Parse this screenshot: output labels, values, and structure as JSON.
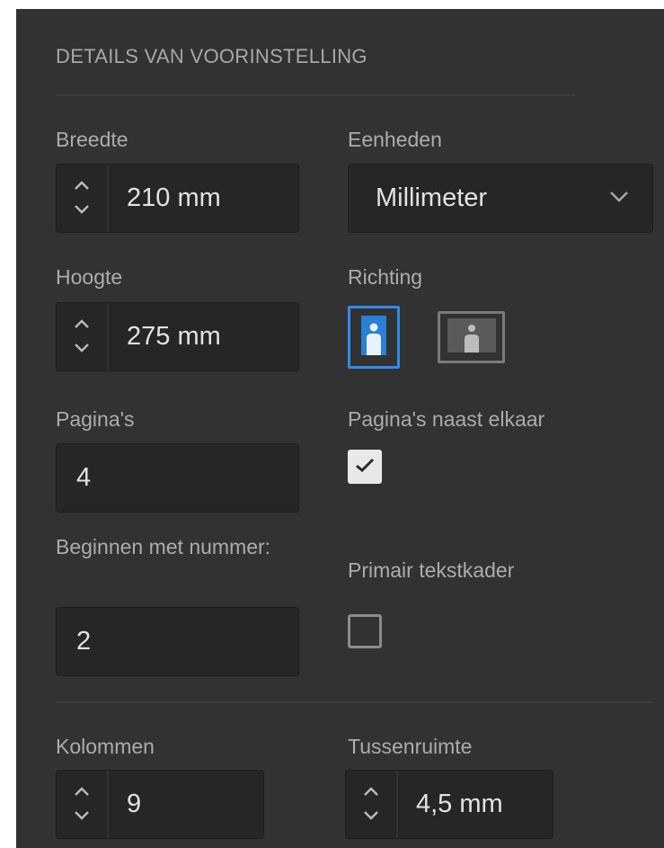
{
  "section_title": "DETAILS VAN VOORINSTELLING",
  "width": {
    "label": "Breedte",
    "value": "210 mm"
  },
  "units": {
    "label": "Eenheden",
    "value": "Millimeter"
  },
  "height": {
    "label": "Hoogte",
    "value": "275 mm"
  },
  "orientation": {
    "label": "Richting",
    "selected": "portrait",
    "accent_color": "#2d8ceb"
  },
  "pages": {
    "label": "Pagina's",
    "value": "4"
  },
  "facing_pages": {
    "label": "Pagina's naast elkaar",
    "checked": true
  },
  "start_number": {
    "label": "Beginnen met nummer:",
    "value": "2"
  },
  "primary_text_frame": {
    "label": "Primair tekstkader",
    "checked": false
  },
  "columns": {
    "label": "Kolommen",
    "value": "9"
  },
  "gutter": {
    "label": "Tussenruimte",
    "value": "4,5 mm"
  },
  "icons": {
    "stepper_up": "chevron-up-icon",
    "stepper_down": "chevron-down-icon",
    "dropdown": "chevron-down-icon",
    "portrait": "portrait-orientation-icon",
    "landscape": "landscape-orientation-icon",
    "check": "checkmark-icon"
  }
}
